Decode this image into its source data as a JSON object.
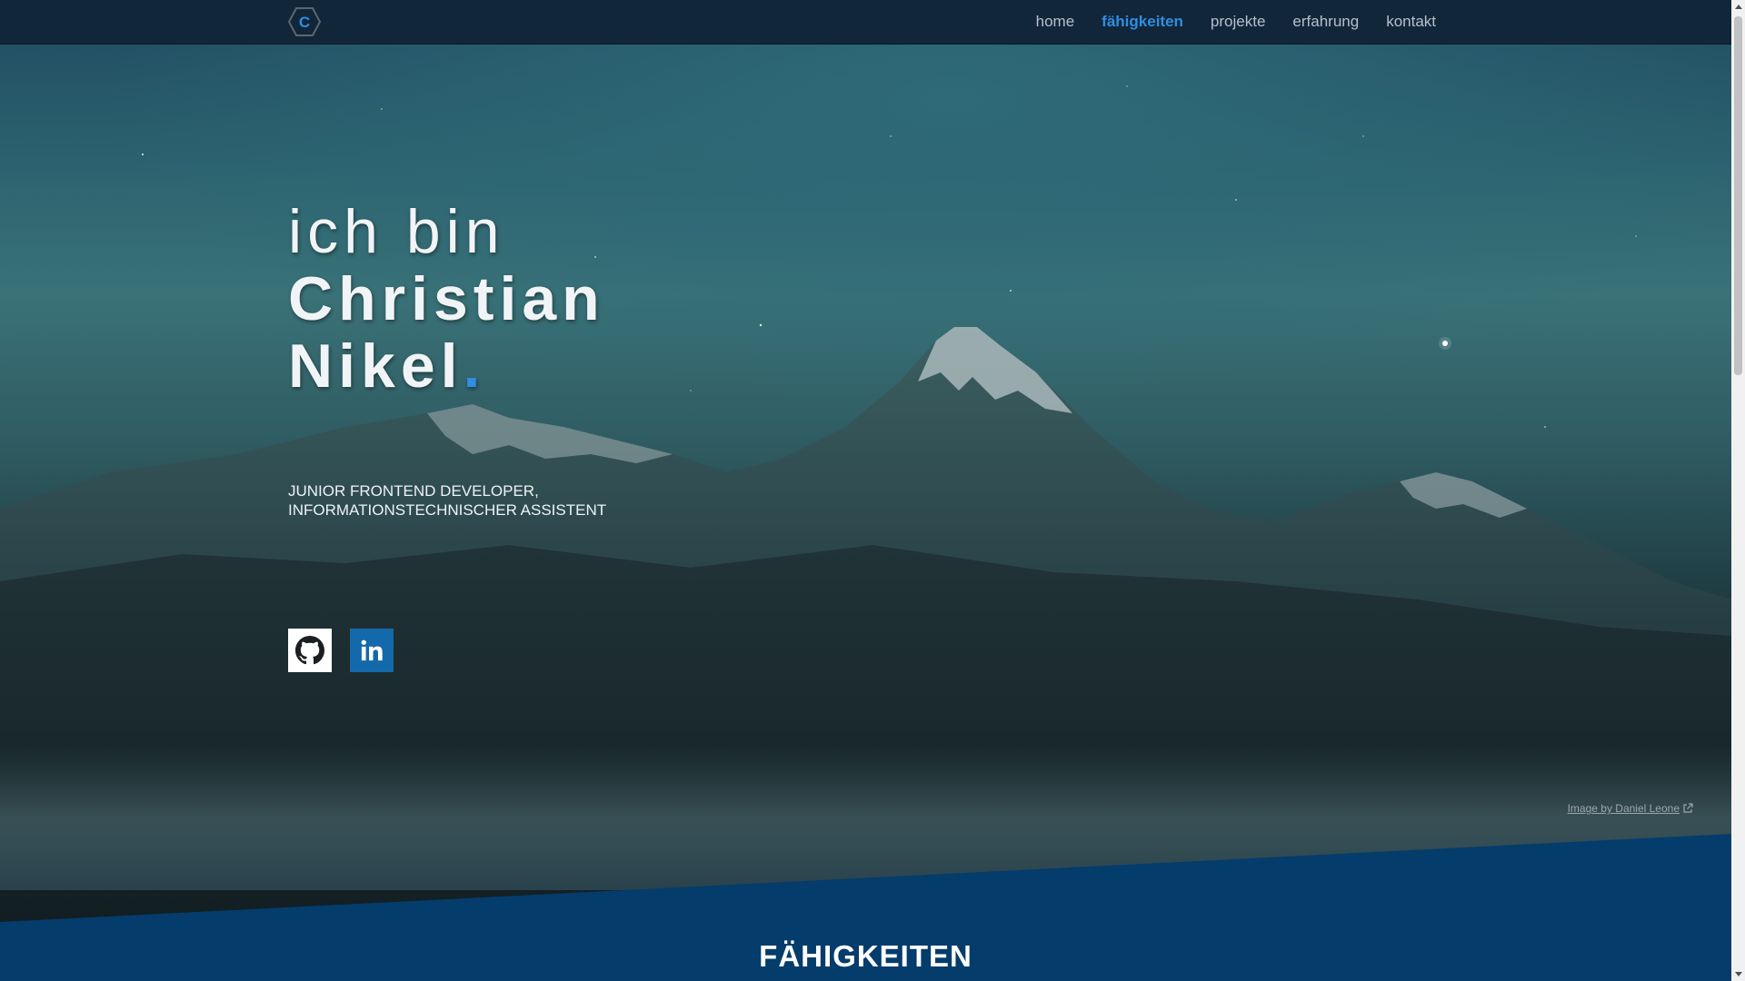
{
  "nav": {
    "logo_letter": "C",
    "links": [
      {
        "label": "home",
        "active": false
      },
      {
        "label": "fähigkeiten",
        "active": true
      },
      {
        "label": "projekte",
        "active": false
      },
      {
        "label": "erfahrung",
        "active": false
      },
      {
        "label": "kontakt",
        "active": false
      }
    ]
  },
  "hero": {
    "line1": "ich bin",
    "line2": "Christian",
    "line3": "Nikel",
    "dot": ".",
    "subtitle_line1": "JUNIOR FRONTEND DEVELOPER,",
    "subtitle_line2": "INFORMATIONSTECHNISCHER ASSISTENT",
    "socials": [
      {
        "icon": "github-icon"
      },
      {
        "icon": "linkedin-icon"
      }
    ],
    "image_credit": "Image by Daniel Leone"
  },
  "section": {
    "title": "FÄHIGKEITEN"
  },
  "colors": {
    "accent": "#2f8ee0",
    "navbar": "#12263a",
    "section_band": "#043c6c",
    "linkedin": "#1469aa"
  }
}
